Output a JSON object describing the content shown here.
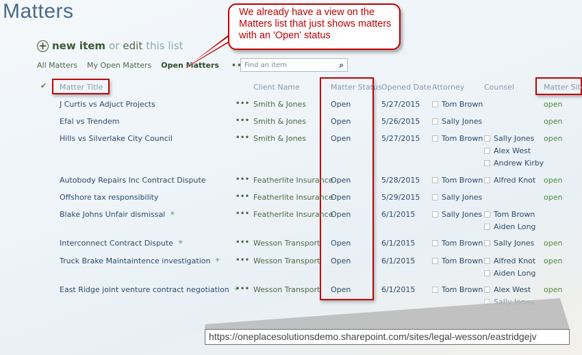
{
  "page": {
    "title": "Matters"
  },
  "commands": {
    "new_item": "new item",
    "or": "or",
    "edit": "edit",
    "this_list": "this list"
  },
  "views": {
    "items": [
      "All Matters",
      "My Open Matters",
      "Open Matters"
    ],
    "active": "Open Matters",
    "more": "•••"
  },
  "search": {
    "placeholder": "Find an item"
  },
  "columns": {
    "title": "Matter Title",
    "client": "Client Name",
    "status": "Matter Status",
    "opened": "Opened Date",
    "attorney": "Attorney",
    "counsel": "Counsel",
    "site": "Matter Site"
  },
  "rows": [
    {
      "title": "J Curtis vs Adjuct Projects",
      "is_new": false,
      "client": "Smith & Jones",
      "status": "Open",
      "opened": "5/27/2015",
      "attorney": "Tom Brown",
      "counsel": [],
      "site": "open"
    },
    {
      "title": "Efal vs Trendem",
      "is_new": false,
      "client": "Smith & Jones",
      "status": "Open",
      "opened": "5/26/2015",
      "attorney": "Sally Jones",
      "counsel": [],
      "site": "open"
    },
    {
      "title": "Hills vs Silverlake City Council",
      "is_new": false,
      "client": "Smith & Jones",
      "status": "Open",
      "opened": "5/27/2015",
      "attorney": "Tom Brown",
      "counsel": [
        "Sally Jones",
        "Alex West",
        "Andrew Kirby"
      ],
      "site": "open"
    },
    {
      "title": "Autobody Repairs Inc Contract Dispute",
      "is_new": false,
      "client": "Featherlite Insurance",
      "status": "Open",
      "opened": "5/28/2015",
      "attorney": "Tom Brown",
      "counsel": [
        "Alfred Knot"
      ],
      "site": "open"
    },
    {
      "title": "Offshore tax responsibility",
      "is_new": false,
      "client": "Featherlite Insurance",
      "status": "Open",
      "opened": "5/29/2015",
      "attorney": "Sally Jones",
      "counsel": [],
      "site": "open"
    },
    {
      "title": "Blake Johns Unfair dismissal",
      "is_new": true,
      "client": "Featherlite Insurance",
      "status": "Open",
      "opened": "6/1/2015",
      "attorney": "Sally Jones",
      "counsel": [
        "Tom Brown",
        "Aiden Long"
      ],
      "site": ""
    },
    {
      "title": "Interconnect Contract Dispute",
      "is_new": true,
      "client": "Wesson Transport",
      "status": "Open",
      "opened": "6/1/2015",
      "attorney": "Tom Brown",
      "counsel": [
        "Sally Jones"
      ],
      "site": "open"
    },
    {
      "title": "Truck Brake Maintaintence investigation",
      "is_new": true,
      "client": "Wesson Transport",
      "status": "Open",
      "opened": "6/1/2015",
      "attorney": "Tom Brown",
      "counsel": [
        "Alfred Knot",
        "Aiden Long"
      ],
      "site": "open"
    },
    {
      "title": "East Ridge joint venture contract negotiation",
      "is_new": true,
      "client": "Wesson Transport",
      "status": "Open",
      "opened": "6/1/2015",
      "attorney": "Tom Brown",
      "counsel": [
        "Alex West",
        "Sally Jones"
      ],
      "site": "open"
    }
  ],
  "annotation": {
    "callout_text": "We already have a view on the Matters list that just shows matters with an 'Open' status",
    "url": "https://oneplacesolutionsdemo.sharepoint.com/sites/legal-wesson/eastridgejv"
  },
  "colors": {
    "highlight": "#c00000",
    "link_green": "#4d6a42",
    "title_blue": "#2b4a6b"
  }
}
